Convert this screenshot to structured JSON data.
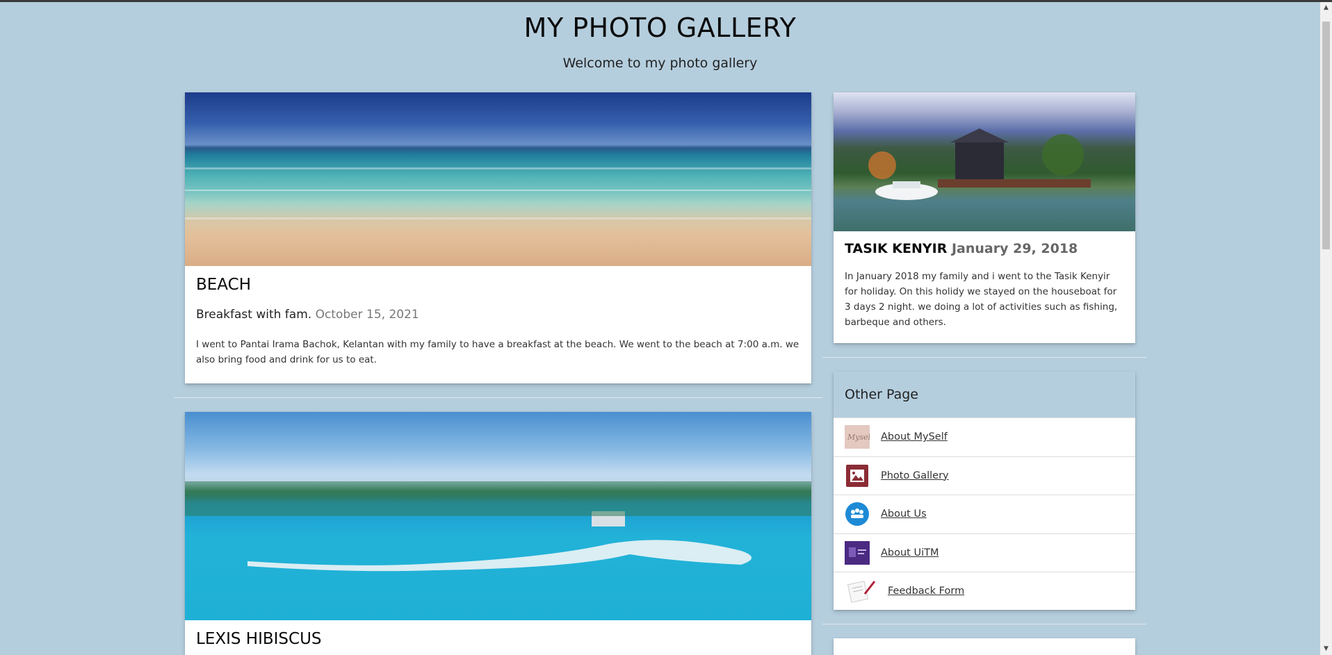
{
  "header": {
    "title": "MY PHOTO GALLERY",
    "subtitle": "Welcome to my photo gallery"
  },
  "posts": [
    {
      "title": "BEACH",
      "caption": "Breakfast with fam.",
      "date": "October 15, 2021",
      "text": "I went to Pantai Irama Bachok, Kelantan with my family to have a breakfast at the beach. We went to the beach at 7:00 a.m. we also bring food and drink for us to eat."
    },
    {
      "title": "LEXIS HIBISCUS"
    }
  ],
  "sidebar": {
    "feature": {
      "title": "TASIK KENYIR",
      "date": "January 29, 2018",
      "text": "In January 2018 my family and i went to the Tasik Kenyir for holiday. On this holidy we stayed on the houseboat for 3 days 2 night. we doing a lot of activities such as fishing, barbeque and others."
    },
    "other_pages": {
      "heading": "Other Page",
      "links": [
        {
          "label": "About MySelf",
          "icon": "myself-thumbnail-icon"
        },
        {
          "label": "Photo Gallery",
          "icon": "photo-gallery-icon"
        },
        {
          "label": "About Us",
          "icon": "about-us-icon"
        },
        {
          "label": "About UiTM",
          "icon": "uitm-icon"
        },
        {
          "label": "Feedback Form",
          "icon": "feedback-form-icon"
        }
      ]
    }
  },
  "colors": {
    "page_background": "#b5cede",
    "card_background": "#ffffff"
  }
}
